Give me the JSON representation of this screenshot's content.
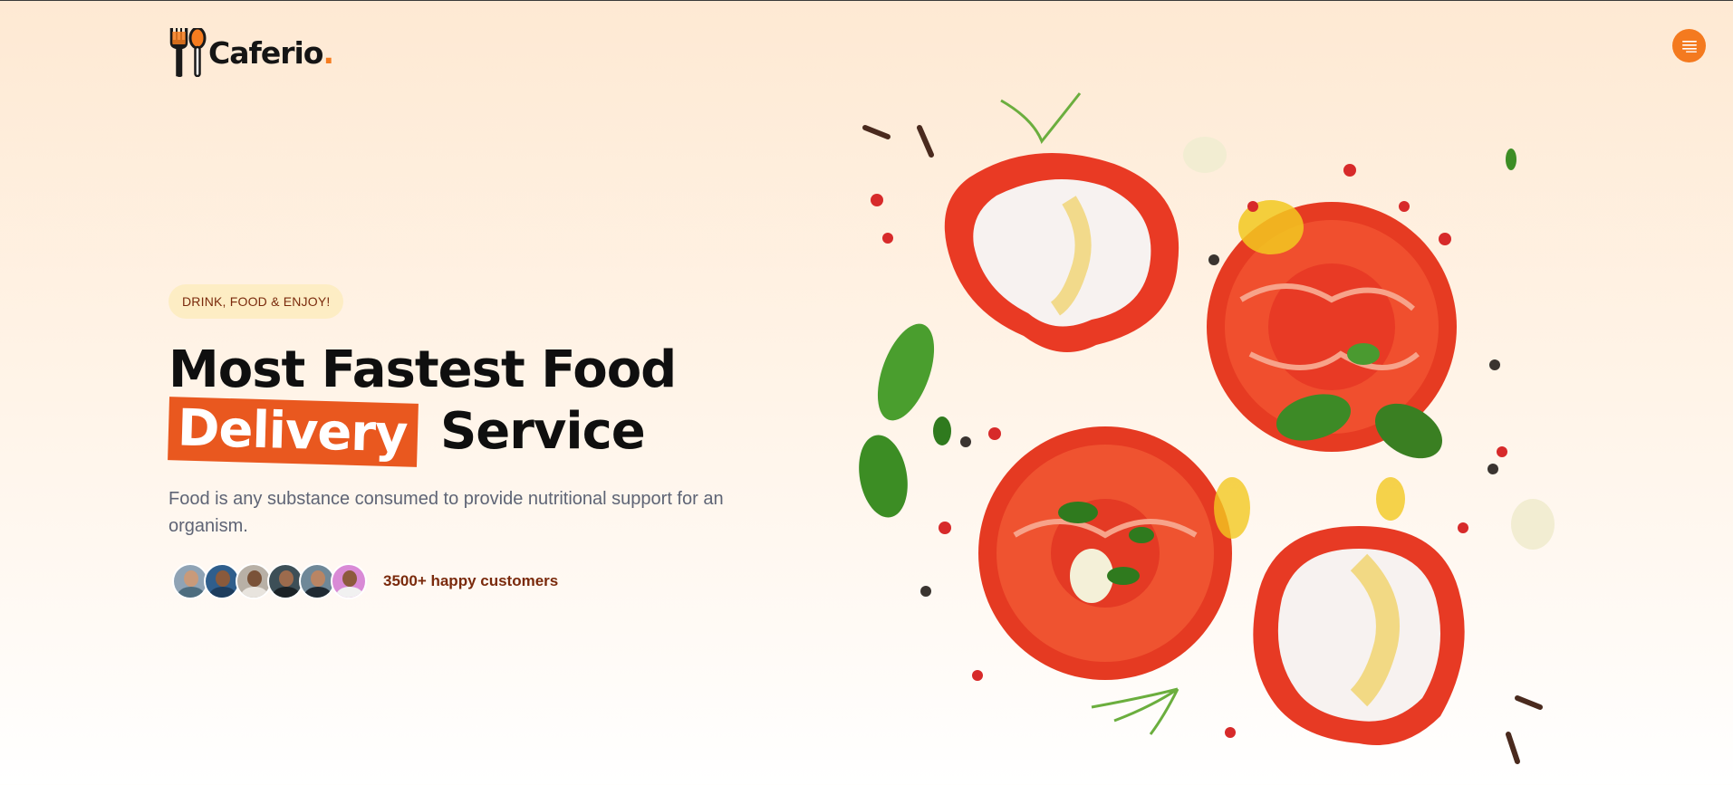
{
  "brand": {
    "name": "Caferio",
    "dot": ".",
    "accent_color": "#f57c1f"
  },
  "header": {
    "menu_icon": "hamburger-menu-icon"
  },
  "hero": {
    "tag": "DRINK, FOOD & ENJOY!",
    "title_line1": "Most Fastest Food",
    "title_highlight": "Delivery",
    "title_line2_rest": "Service",
    "description": "Food is any substance consumed to provide nutritional support for an organism.",
    "customers_text": "3500+ happy customers",
    "highlight_color": "#e9581f"
  },
  "avatars": [
    {
      "name": "avatar-1",
      "bg": "#8fa3b5",
      "face": "#c99a7a",
      "body": "#4d6d7f"
    },
    {
      "name": "avatar-2",
      "bg": "#2f5e8c",
      "face": "#8a5a3c",
      "body": "#1d3d5e"
    },
    {
      "name": "avatar-3",
      "bg": "#b8b0a6",
      "face": "#7a5238",
      "body": "#e8e4de"
    },
    {
      "name": "avatar-4",
      "bg": "#3d4f57",
      "face": "#9c6b4d",
      "body": "#1b2226"
    },
    {
      "name": "avatar-5",
      "bg": "#6f8898",
      "face": "#b98564",
      "body": "#1f2a33"
    },
    {
      "name": "avatar-6",
      "bg": "#d98ad6",
      "face": "#8c5a3d",
      "body": "#f1f1f1"
    }
  ]
}
